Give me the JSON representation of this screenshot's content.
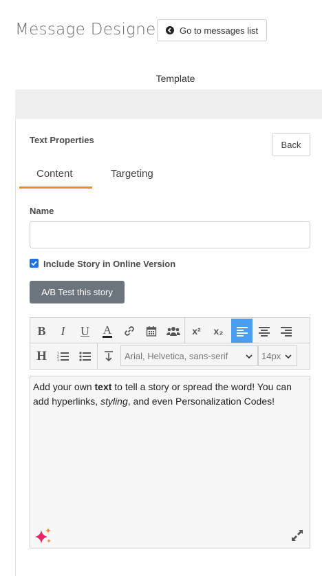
{
  "header": {
    "title": "Message Designer",
    "go_button_label": "Go to messages list"
  },
  "template_label": "Template",
  "panel": {
    "title": "Text Properties",
    "back_label": "Back",
    "tabs": [
      {
        "label": "Content",
        "active": true
      },
      {
        "label": "Targeting",
        "active": false
      }
    ]
  },
  "form": {
    "name_label": "Name",
    "name_value": "",
    "name_placeholder": "",
    "include_label": "Include Story in Online Version",
    "include_checked": true,
    "ab_button_label": "A/B Test this story"
  },
  "toolbar": {
    "row1": [
      {
        "icon": "bold-icon",
        "glyph": "B"
      },
      {
        "icon": "italic-icon",
        "glyph": "I"
      },
      {
        "icon": "underline-icon",
        "glyph": "U"
      },
      {
        "icon": "font-color-icon",
        "glyph": "A"
      },
      {
        "icon": "link-icon",
        "glyph": "🔗"
      },
      {
        "icon": "calendar-icon",
        "glyph": "📅"
      },
      {
        "icon": "users-icon",
        "glyph": "👥"
      },
      {
        "icon": "superscript-icon",
        "glyph": "x²"
      },
      {
        "icon": "subscript-icon",
        "glyph": "x₂"
      },
      {
        "icon": "align-left-icon",
        "glyph": ""
      },
      {
        "icon": "align-center-icon",
        "glyph": ""
      },
      {
        "icon": "align-right-icon",
        "glyph": ""
      }
    ],
    "font_family_value": "Arial, Helvetica, sans-serif",
    "font_size_value": "14px",
    "accent_color": "#4a9ef1"
  },
  "editor": {
    "segment1": "Add your own ",
    "segment_bold": "text",
    "segment2": " to tell a story or spread the word! You can add hyperlinks, ",
    "segment_italic": "styling",
    "segment3": ", and even Personalization Codes!"
  },
  "colors": {
    "tab_underline": "#ef8a2a",
    "ab_button_bg": "#6c757d",
    "checkbox": "#1a73e8",
    "sparkle": "#e8246a"
  }
}
